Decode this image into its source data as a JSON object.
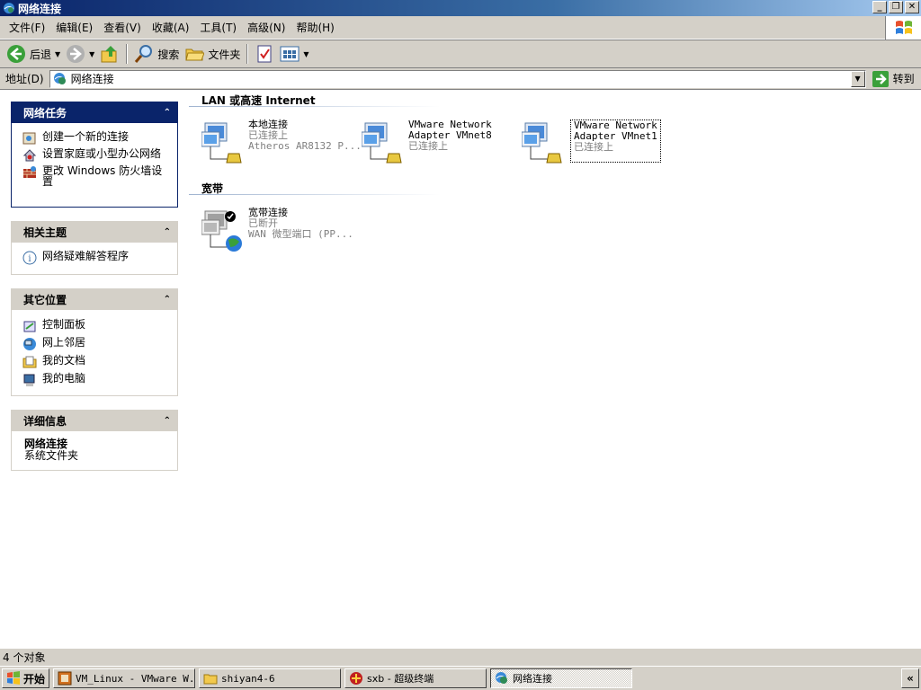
{
  "window": {
    "title": "网络连接",
    "controls": [
      "_",
      "❐",
      "✕"
    ]
  },
  "menubar": {
    "items": [
      "文件(F)",
      "编辑(E)",
      "查看(V)",
      "收藏(A)",
      "工具(T)",
      "高级(N)",
      "帮助(H)"
    ]
  },
  "toolbar": {
    "back_label": "后退",
    "search_label": "搜索",
    "folders_label": "文件夹"
  },
  "addressbar": {
    "label": "地址(D)",
    "value": "网络连接",
    "go_label": "转到"
  },
  "sidebar": {
    "network_tasks": {
      "title": "网络任务",
      "items": [
        {
          "label": "创建一个新的连接",
          "icon": "new-connection-icon"
        },
        {
          "label": "设置家庭或小型办公网络",
          "icon": "home-network-icon"
        },
        {
          "label": "更改 Windows 防火墙设置",
          "icon": "firewall-icon"
        }
      ]
    },
    "related_topics": {
      "title": "相关主题",
      "items": [
        {
          "label": "网络疑难解答程序",
          "icon": "info-icon"
        }
      ]
    },
    "other_places": {
      "title": "其它位置",
      "items": [
        {
          "label": "控制面板",
          "icon": "control-panel-icon"
        },
        {
          "label": "网上邻居",
          "icon": "network-places-icon"
        },
        {
          "label": "我的文档",
          "icon": "my-documents-icon"
        },
        {
          "label": "我的电脑",
          "icon": "my-computer-icon"
        }
      ]
    },
    "details": {
      "title": "详细信息",
      "name": "网络连接",
      "type": "系统文件夹"
    }
  },
  "main": {
    "lan_group": {
      "title": "LAN 或高速 Internet",
      "connections": [
        {
          "name": "本地连接",
          "status": "已连接上",
          "device": "Atheros AR8132 P..."
        },
        {
          "name": "VMware Network Adapter VMnet8",
          "name_line1": "VMware Network",
          "name_line2": "Adapter VMnet8",
          "status": "已连接上",
          "device": ""
        },
        {
          "name": "VMware Network Adapter VMnet1",
          "name_line1": "VMware Network",
          "name_line2": "Adapter VMnet1",
          "status": "已连接上",
          "device": ""
        }
      ]
    },
    "broadband_group": {
      "title": "宽带",
      "connections": [
        {
          "name": "宽带连接",
          "status": "已断开",
          "device": "WAN 微型端口 (PP..."
        }
      ]
    }
  },
  "statusbar": {
    "text": "4 个对象"
  },
  "taskbar": {
    "start_label": "开始",
    "buttons": [
      {
        "label": "VM_Linux - VMware W...",
        "icon": "vmware-icon"
      },
      {
        "label": "shiyan4-6",
        "icon": "folder-icon"
      },
      {
        "label": "sxb - 超级终端",
        "icon": "hyperterminal-icon"
      },
      {
        "label": "网络连接",
        "icon": "network-connections-icon",
        "active": true
      }
    ],
    "tray_label": "«"
  },
  "colors": {
    "title_active": "#0a246a",
    "panel_header": "#0a246a",
    "face": "#d4d0c8"
  }
}
